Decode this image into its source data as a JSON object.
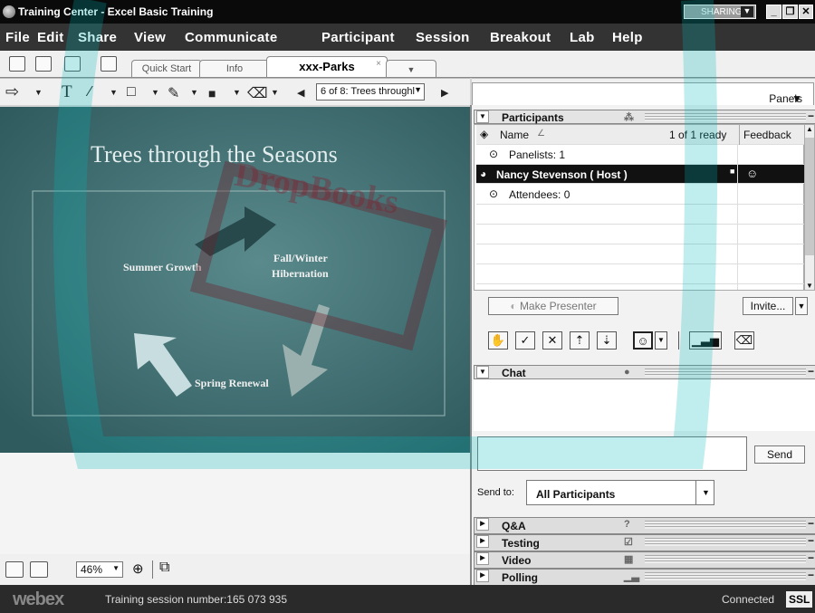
{
  "window": {
    "title": "Training Center - Excel Basic Training",
    "sharing_label": "SHARING"
  },
  "menu": [
    "File",
    "Edit",
    "Share",
    "View",
    "Communicate",
    "Participant",
    "Session",
    "Breakout",
    "Lab",
    "Help"
  ],
  "tabs": {
    "quick_start": "Quick Start",
    "info": "Info",
    "active": "xxx-Parks",
    "close_glyph": "×",
    "dropdown_glyph": "▼"
  },
  "toolbar": {
    "page_selector": "6 of 8: Trees throughl"
  },
  "panels": {
    "label": "Panels"
  },
  "slide": {
    "title": "Trees through the Seasons",
    "labels": {
      "summer": "Summer Growth",
      "fall1": "Fall/Winter",
      "fall2": "Hibernation",
      "spring": "Spring Renewal"
    }
  },
  "participants": {
    "header": "Participants",
    "column_name": "Name",
    "sort_glyph": "∠",
    "ready": "1 of 1 ready",
    "feedback": "Feedback",
    "panelists": "Panelists: 1",
    "host": "Nancy Stevenson ( Host )",
    "attendees": "Attendees: 0",
    "make_presenter": "Make Presenter",
    "invite": "Invite..."
  },
  "chat": {
    "header": "Chat",
    "send": "Send",
    "send_to_label": "Send to:",
    "send_to_value": "All Participants"
  },
  "collapsed_panels": [
    "Q&A",
    "Testing",
    "Video",
    "Polling"
  ],
  "zoom": {
    "value": "46%"
  },
  "status": {
    "brand": "webex",
    "session": "Training session number:165 073 935",
    "connection": "Connected",
    "ssl": "SSL"
  },
  "watermark": {
    "text": "DropBooks"
  }
}
